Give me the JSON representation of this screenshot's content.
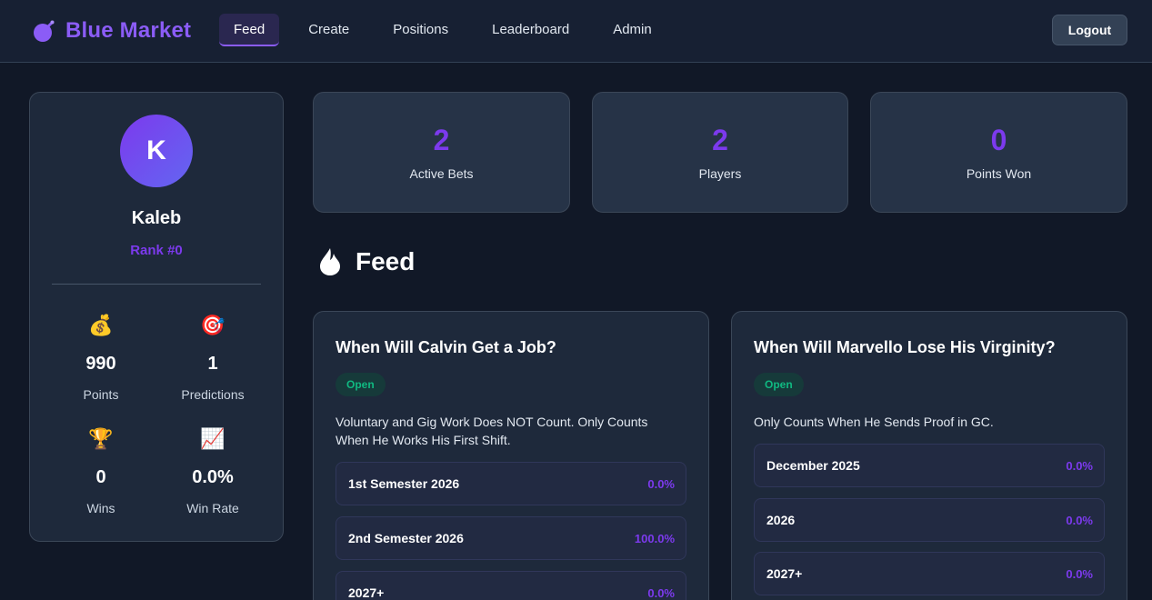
{
  "header": {
    "brand": "Blue Market",
    "nav": [
      {
        "label": "Feed",
        "active": true
      },
      {
        "label": "Create"
      },
      {
        "label": "Positions"
      },
      {
        "label": "Leaderboard"
      },
      {
        "label": "Admin"
      }
    ],
    "logout": "Logout"
  },
  "profile": {
    "initial": "K",
    "name": "Kaleb",
    "rank": "Rank #0",
    "stats": [
      {
        "icon": "money-bag-icon",
        "value": "990",
        "label": "Points"
      },
      {
        "icon": "target-icon",
        "value": "1",
        "label": "Predictions"
      },
      {
        "icon": "trophy-icon",
        "value": "0",
        "label": "Wins"
      },
      {
        "icon": "chart-increasing-icon",
        "value": "0.0%",
        "label": "Win Rate"
      }
    ]
  },
  "summary": [
    {
      "value": "2",
      "label": "Active Bets"
    },
    {
      "value": "2",
      "label": "Players"
    },
    {
      "value": "0",
      "label": "Points Won"
    }
  ],
  "feed": {
    "title": "Feed",
    "bets": [
      {
        "title": "When Will Calvin Get a Job?",
        "status": "Open",
        "description": "Voluntary and Gig Work Does NOT Count. Only Counts When He Works His First Shift.",
        "options": [
          {
            "label": "1st Semester 2026",
            "percent": "0.0%"
          },
          {
            "label": "2nd Semester 2026",
            "percent": "100.0%"
          },
          {
            "label": "2027+",
            "percent": "0.0%"
          }
        ]
      },
      {
        "title": "When Will Marvello Lose His Virginity?",
        "status": "Open",
        "description": "Only Counts When He Sends Proof in GC.",
        "options": [
          {
            "label": "December 2025",
            "percent": "0.0%"
          },
          {
            "label": "2026",
            "percent": "0.0%"
          },
          {
            "label": "2027+",
            "percent": "0.0%"
          }
        ]
      }
    ]
  },
  "colors": {
    "accent": "#7c3aed",
    "open": "#10b981",
    "background": "#111827"
  }
}
